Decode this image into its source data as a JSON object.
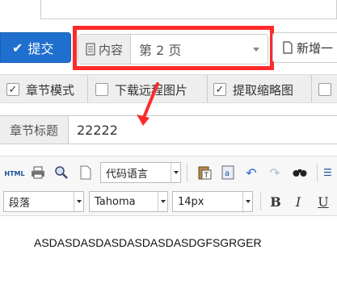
{
  "submit": {
    "label": "提交",
    "icon": "check-icon"
  },
  "content_select": {
    "addon_label": "内容",
    "addon_icon": "document-icon",
    "value": "第 2 页"
  },
  "add_button": {
    "label": "新增一",
    "icon": "document-icon"
  },
  "options": [
    {
      "label": "章节模式",
      "checked": true
    },
    {
      "label": "下载远程图片",
      "checked": false
    },
    {
      "label": "提取缩略图",
      "checked": true
    }
  ],
  "chapter_title": {
    "label": "章节标题",
    "value": "22222"
  },
  "toolbar": {
    "html_label": "HTML",
    "code_language": "代码语言",
    "paragraph": "段落",
    "font_family": "Tahoma",
    "font_size": "14px",
    "bold": "B",
    "italic": "I",
    "underline": "U"
  },
  "editor_content": "ASDASDASDASDASDASDASDGFSGRGER",
  "colors": {
    "accent": "#1f6fcf",
    "highlight": "#ff2a2a"
  }
}
